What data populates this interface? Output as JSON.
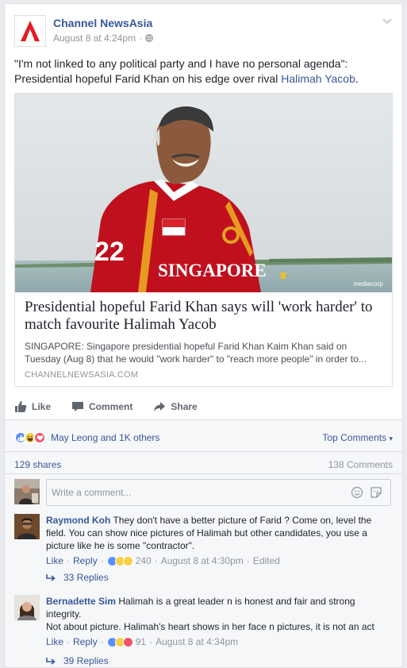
{
  "post": {
    "page_name": "Channel NewsAsia",
    "date": "August 8 at 4:24pm",
    "dot": "·",
    "status_text": "\"I'm not linked to any political party and I have no personal agenda\": Presidential hopeful Farid Khan on his edge over rival ",
    "status_link": "Halimah Yacob",
    "status_end": "."
  },
  "attachment": {
    "title": "Presidential hopeful Farid Khan says will 'work harder' to match favourite Halimah Yacob",
    "description": "SINGAPORE: Singapore presidential hopeful Farid Khan Kaim Khan said on Tuesday (Aug 8) that he would \"work harder\" to \"reach more people\" in order to...",
    "domain": "CHANNELNEWSASIA.COM",
    "shirt_text": "SINGAPORE",
    "shirt_number": "22",
    "watermark": "mediacorp"
  },
  "actions": {
    "like": "Like",
    "comment": "Comment",
    "share": "Share"
  },
  "reactions": {
    "names": "May Leong and 1K others",
    "top_comments": "Top Comments",
    "top_comments_caret": "▾"
  },
  "stats": {
    "shares": "129 shares",
    "comments": "138 Comments"
  },
  "comment_box": {
    "placeholder": "Write a comment..."
  },
  "comments": [
    {
      "name": "Raymond Koh",
      "text": "They don't have a better picture of Farid ? Come on, level the field. You can show nice pictures of Halimah but other candidates, you use a picture like he is some \"contractor\".",
      "like": "Like",
      "reply": "Reply",
      "count": "240",
      "time": "August 8 at 4:30pm",
      "edited": "Edited",
      "replies": "33 Replies"
    },
    {
      "name": "Bernadette Sim",
      "text": "Halimah is a great leader n is honest and fair and strong integrity.",
      "text2": "Not about picture. Halimah's heart shows in her face n pictures, it is not an act",
      "like": "Like",
      "reply": "Reply",
      "count": "91",
      "time": "August 8 at 4:34pm",
      "replies": "39 Replies"
    }
  ],
  "colors": {
    "link": "#365899",
    "like_blue": "#5890ff",
    "love_red": "#f25268",
    "haha_yellow": "#f7d046",
    "logo_red": "#e31b23"
  }
}
